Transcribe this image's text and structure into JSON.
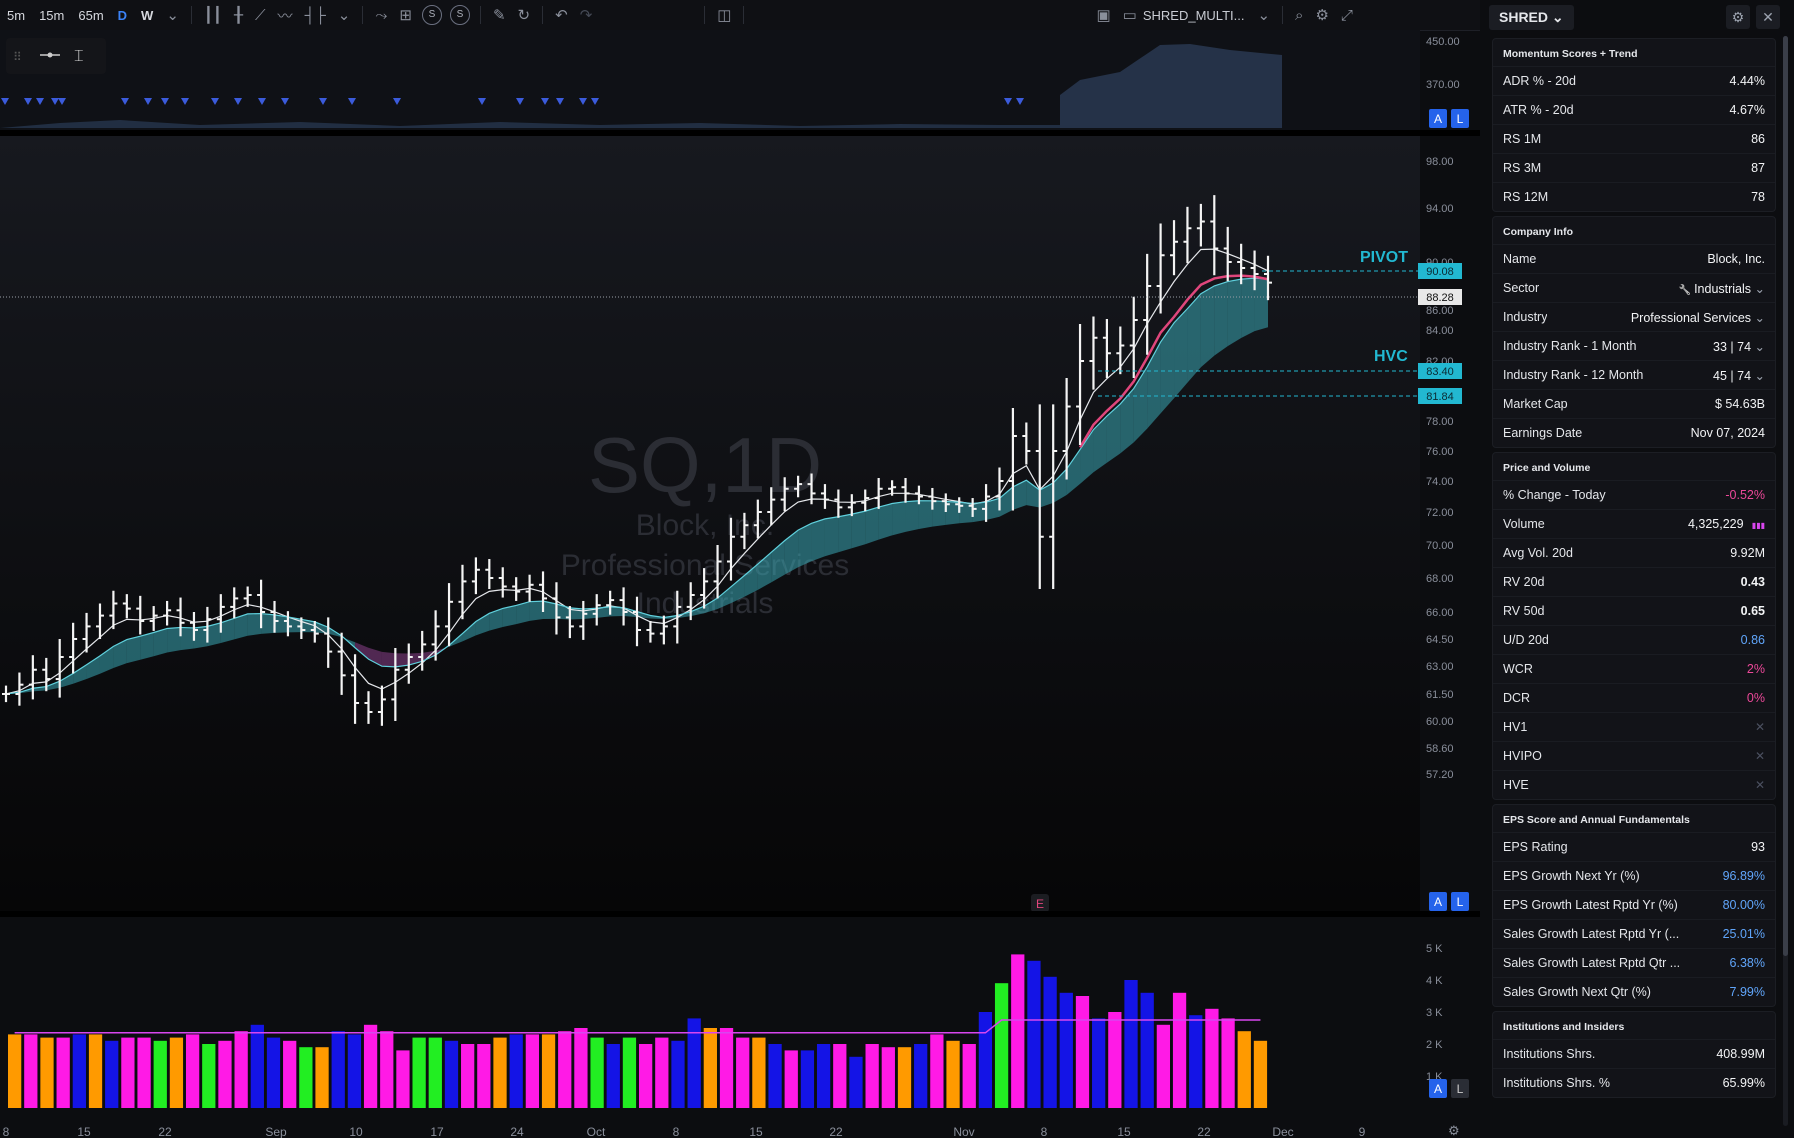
{
  "toolbar": {
    "timeframes": [
      "5m",
      "15m",
      "65m",
      "D",
      "W"
    ],
    "active_timeframe": "D",
    "compare_badges": [
      "S",
      "S"
    ],
    "layout_name": "SHRED_MULTI..."
  },
  "chart": {
    "watermark_symbol": "SQ,1D",
    "watermark_name": "Block, Inc.",
    "watermark_industry": "Professional Services",
    "watermark_sector": "Industrials",
    "pivot_label": "PIVOT",
    "hvc_label": "HVC",
    "earnings_marker": "E",
    "price_tags": {
      "pivot": "90.08",
      "last": "88.28",
      "hvc": "83.40",
      "low": "81.84"
    },
    "price_axis": [
      "98.00",
      "94.00",
      "90.00",
      "86.00",
      "84.00",
      "82.00",
      "80.00",
      "78.00",
      "76.00",
      "74.00",
      "72.00",
      "70.00",
      "68.00",
      "66.00",
      "64.50",
      "63.00",
      "61.50",
      "60.00",
      "58.60",
      "57.20"
    ],
    "top_axis": [
      "450.00",
      "370.00"
    ],
    "volume_axis": [
      "5 K",
      "4 K",
      "3 K",
      "2 K",
      "1 K"
    ],
    "x_axis": [
      "8",
      "15",
      "22",
      "Sep",
      "10",
      "17",
      "24",
      "Oct",
      "8",
      "15",
      "22",
      "Nov",
      "8",
      "15",
      "22",
      "Dec",
      "9"
    ],
    "scale_buttons": [
      "A",
      "L"
    ],
    "colors": {
      "up_ma": "#5fd0dc",
      "down_ma": "#c64ab9",
      "pink_ma": "#e0467c",
      "tag": "#22b8d1",
      "vol_magenta": "#ff1ae6",
      "vol_blue": "#1414e6",
      "vol_green": "#22ee22",
      "vol_orange": "#ff9a00"
    }
  },
  "panel": {
    "watchlist": "SHRED",
    "sections": [
      {
        "title": "Momentum Scores + Trend",
        "rows": [
          {
            "label": "ADR % - 20d",
            "value": "4.44%"
          },
          {
            "label": "ATR % - 20d",
            "value": "4.67%"
          },
          {
            "label": "RS 1M",
            "value": "86"
          },
          {
            "label": "RS 3M",
            "value": "87"
          },
          {
            "label": "RS 12M",
            "value": "78"
          }
        ]
      },
      {
        "title": "Company Info",
        "rows": [
          {
            "label": "Name",
            "value": "Block, Inc."
          },
          {
            "label": "Sector",
            "value": "Industrials",
            "dropdown": true,
            "icon": "wrench-icon"
          },
          {
            "label": "Industry",
            "value": "Professional Services",
            "dropdown": true
          },
          {
            "label": "Industry Rank - 1 Month",
            "value": "33 | 74",
            "dropdown": true
          },
          {
            "label": "Industry Rank - 12 Month",
            "value": "45 | 74",
            "dropdown": true
          },
          {
            "label": "Market Cap",
            "value": "$ 54.63B"
          },
          {
            "label": "Earnings Date",
            "value": "Nov 07, 2024"
          }
        ]
      },
      {
        "title": "Price and Volume",
        "rows": [
          {
            "label": "% Change - Today",
            "value": "-0.52%",
            "color": "pink"
          },
          {
            "label": "Volume",
            "value": "4,325,229",
            "icon": "volume-bars-icon"
          },
          {
            "label": "Avg Vol. 20d",
            "value": "9.92M"
          },
          {
            "label": "RV 20d",
            "value": "0.43",
            "bold": true
          },
          {
            "label": "RV 50d",
            "value": "0.65",
            "bold": true
          },
          {
            "label": "U/D 20d",
            "value": "0.86",
            "color": "blue"
          },
          {
            "label": "WCR",
            "value": "2%",
            "color": "pink"
          },
          {
            "label": "DCR",
            "value": "0%",
            "color": "pink"
          },
          {
            "label": "HV1",
            "value": "✕",
            "xmark": true
          },
          {
            "label": "HVIPO",
            "value": "✕",
            "xmark": true
          },
          {
            "label": "HVE",
            "value": "✕",
            "xmark": true
          }
        ]
      },
      {
        "title": "EPS Score and Annual Fundamentals",
        "rows": [
          {
            "label": "EPS Rating",
            "value": "93"
          },
          {
            "label": "EPS Growth Next Yr (%)",
            "value": "96.89%",
            "color": "blue"
          },
          {
            "label": "EPS Growth Latest Rptd Yr (%)",
            "value": "80.00%",
            "color": "blue"
          },
          {
            "label": "Sales Growth Latest Rptd Yr (...",
            "value": "25.01%",
            "color": "blue"
          },
          {
            "label": "Sales Growth Latest Rptd Qtr ...",
            "value": "6.38%",
            "color": "blue"
          },
          {
            "label": "Sales Growth Next Qtr (%)",
            "value": "7.99%",
            "color": "blue"
          }
        ]
      },
      {
        "title": "Institutions and Insiders",
        "rows": [
          {
            "label": "Institutions Shrs.",
            "value": "408.99M"
          },
          {
            "label": "Institutions Shrs. %",
            "value": "65.99%"
          }
        ]
      }
    ]
  }
}
